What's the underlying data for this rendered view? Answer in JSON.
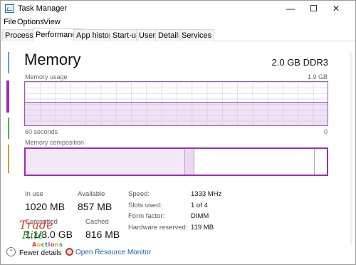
{
  "window": {
    "title": "Task Manager",
    "controls": {
      "minimize": "—",
      "maximize": "",
      "close": "✕"
    }
  },
  "menu": [
    "File",
    "Options",
    "View"
  ],
  "tabs": [
    {
      "label": "Processes",
      "active": false
    },
    {
      "label": "Performance",
      "active": true
    },
    {
      "label": "App history",
      "active": false
    },
    {
      "label": "Start-up",
      "active": false
    },
    {
      "label": "Users",
      "active": false
    },
    {
      "label": "Details",
      "active": false
    },
    {
      "label": "Services",
      "active": false
    }
  ],
  "memory": {
    "title": "Memory",
    "spec": "2.0 GB DDR3",
    "usage_label": "Memory usage",
    "usage_max": "1.9 GB",
    "time_left": "60 seconds",
    "time_right": "0",
    "usage_fraction": 0.54,
    "composition_label": "Memory composition",
    "composition": {
      "in_use": 0.53,
      "modified": 0.03,
      "standby": 0.4,
      "free": 0.04
    }
  },
  "stats": {
    "in_use_label": "In use",
    "in_use_value": "1020 MB",
    "available_label": "Available",
    "available_value": "857 MB",
    "committed_label": "Committed",
    "committed_value": "1.1/3.0 GB",
    "cached_label": "Cached",
    "cached_value": "816 MB"
  },
  "info": [
    {
      "label": "Speed:",
      "value": "1333 MHz"
    },
    {
      "label": "Slots used:",
      "value": "1 of 4"
    },
    {
      "label": "Form factor:",
      "value": "DIMM"
    },
    {
      "label": "Hardware reserved:",
      "value": "119 MB"
    }
  ],
  "footer": {
    "fewer_details": "Fewer details",
    "resource_monitor": "Open Resource Monitor"
  },
  "watermark": {
    "line1": "Trade",
    "line2": "Rite",
    "line3": "Auctions"
  },
  "colors": {
    "accent": "#9b2db3",
    "graph_fill": "#d8c1e6",
    "link": "#1a5fb4"
  }
}
